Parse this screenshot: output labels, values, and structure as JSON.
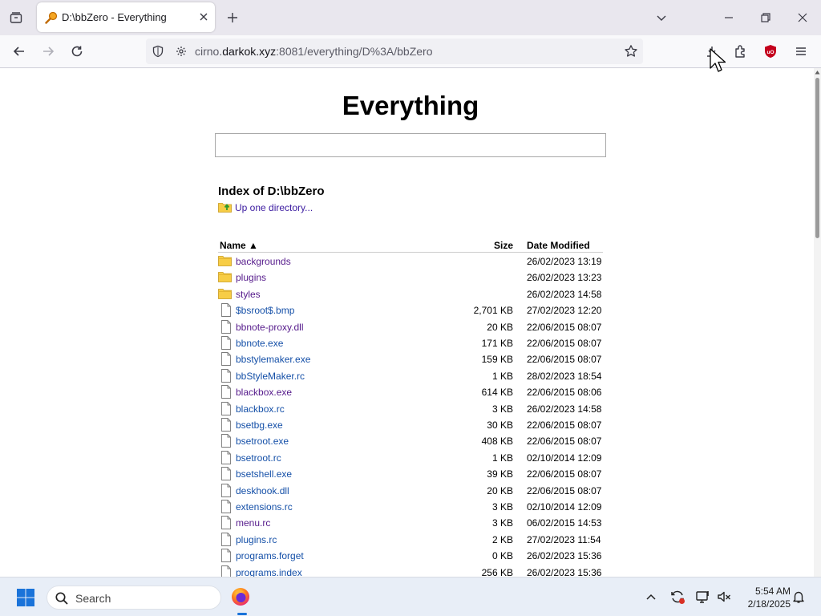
{
  "browser": {
    "tab_title": "D:\\bbZero - Everything",
    "url_prefix": "cirno.",
    "url_host": "darkok.xyz",
    "url_rest": ":8081/everything/D%3A/bbZero"
  },
  "page": {
    "heading": "Everything",
    "search_value": "",
    "index_title": "Index of D:\\bbZero",
    "up_link": "Up one directory...",
    "columns": {
      "name": "Name ▲",
      "size": "Size",
      "date": "Date Modified"
    },
    "rows": [
      {
        "type": "folder",
        "name": "backgrounds",
        "size": "",
        "date": "26/02/2023 13:19",
        "visited": true
      },
      {
        "type": "folder",
        "name": "plugins",
        "size": "",
        "date": "26/02/2023 13:23",
        "visited": true
      },
      {
        "type": "folder",
        "name": "styles",
        "size": "",
        "date": "26/02/2023 14:58",
        "visited": true
      },
      {
        "type": "file",
        "name": "$bsroot$.bmp",
        "size": "2,701 KB",
        "date": "27/02/2023 12:20",
        "visited": false
      },
      {
        "type": "file",
        "name": "bbnote-proxy.dll",
        "size": "20 KB",
        "date": "22/06/2015 08:07",
        "visited": true
      },
      {
        "type": "file",
        "name": "bbnote.exe",
        "size": "171 KB",
        "date": "22/06/2015 08:07",
        "visited": false
      },
      {
        "type": "file",
        "name": "bbstylemaker.exe",
        "size": "159 KB",
        "date": "22/06/2015 08:07",
        "visited": false
      },
      {
        "type": "file",
        "name": "bbStyleMaker.rc",
        "size": "1 KB",
        "date": "28/02/2023 18:54",
        "visited": false
      },
      {
        "type": "file",
        "name": "blackbox.exe",
        "size": "614 KB",
        "date": "22/06/2015 08:06",
        "visited": true
      },
      {
        "type": "file",
        "name": "blackbox.rc",
        "size": "3 KB",
        "date": "26/02/2023 14:58",
        "visited": false
      },
      {
        "type": "file",
        "name": "bsetbg.exe",
        "size": "30 KB",
        "date": "22/06/2015 08:07",
        "visited": false
      },
      {
        "type": "file",
        "name": "bsetroot.exe",
        "size": "408 KB",
        "date": "22/06/2015 08:07",
        "visited": false
      },
      {
        "type": "file",
        "name": "bsetroot.rc",
        "size": "1 KB",
        "date": "02/10/2014 12:09",
        "visited": false
      },
      {
        "type": "file",
        "name": "bsetshell.exe",
        "size": "39 KB",
        "date": "22/06/2015 08:07",
        "visited": false
      },
      {
        "type": "file",
        "name": "deskhook.dll",
        "size": "20 KB",
        "date": "22/06/2015 08:07",
        "visited": false
      },
      {
        "type": "file",
        "name": "extensions.rc",
        "size": "3 KB",
        "date": "02/10/2014 12:09",
        "visited": false
      },
      {
        "type": "file",
        "name": "menu.rc",
        "size": "3 KB",
        "date": "06/02/2015 14:53",
        "visited": true
      },
      {
        "type": "file",
        "name": "plugins.rc",
        "size": "2 KB",
        "date": "27/02/2023 11:54",
        "visited": false
      },
      {
        "type": "file",
        "name": "programs.forget",
        "size": "0 KB",
        "date": "26/02/2023 15:36",
        "visited": false
      },
      {
        "type": "file",
        "name": "programs.index",
        "size": "256 KB",
        "date": "26/02/2023 15:36",
        "visited": false
      }
    ]
  },
  "taskbar": {
    "search_label": "Search",
    "time": "5:54 AM",
    "date": "2/18/2025"
  },
  "icons": [
    "tab-list-icon",
    "everything-favicon-icon",
    "close-icon",
    "new-tab-icon",
    "chevron-down-icon",
    "minimize-icon",
    "restore-icon",
    "window-close-icon",
    "back-icon",
    "forward-icon",
    "reload-icon",
    "shield-icon",
    "lock-icon",
    "bookmark-star-icon",
    "download-icon",
    "extensions-icon",
    "ublock-icon",
    "menu-icon",
    "folder-icon",
    "file-icon",
    "windows-start-icon",
    "search-icon",
    "firefox-icon",
    "chevron-up-icon",
    "sync-icon",
    "network-icon",
    "volume-muted-icon",
    "bell-icon"
  ],
  "colors": {
    "link": "#1550a8",
    "visited_link": "#551a8b",
    "folder": "#f7cd46",
    "ublock": "#c4001c"
  }
}
